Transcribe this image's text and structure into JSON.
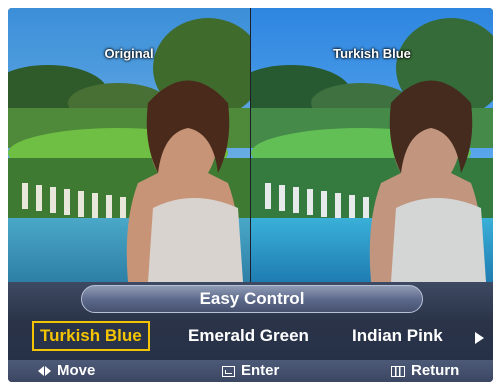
{
  "preview": {
    "left_label": "Original",
    "right_label": "Turkish Blue"
  },
  "menu": {
    "title": "Easy Control",
    "options": [
      "Turkish Blue",
      "Emerald Green",
      "Indian Pink"
    ],
    "selected": "Turkish Blue"
  },
  "hints": {
    "move": "Move",
    "enter": "Enter",
    "return": "Return"
  },
  "colors": {
    "highlight": "#f5c400",
    "menu_bg": "#2a3347"
  }
}
